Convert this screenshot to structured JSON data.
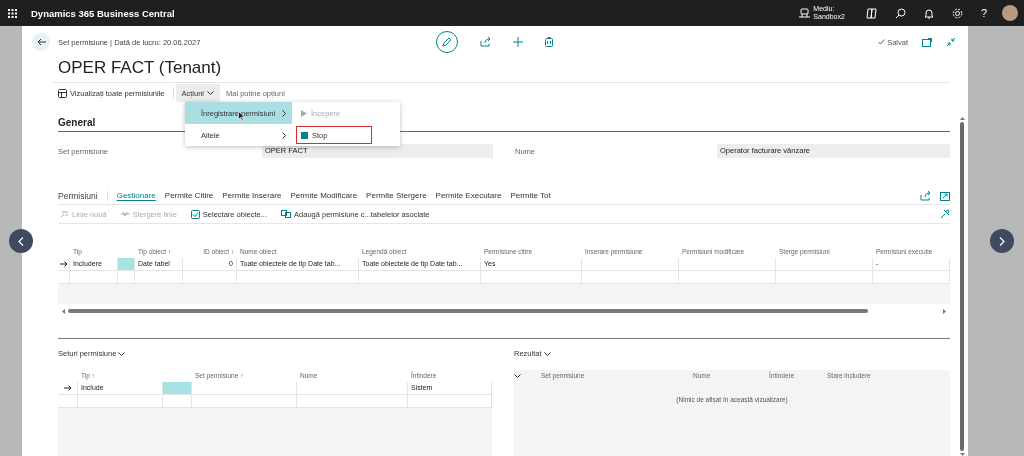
{
  "app_bar": {
    "title": "Dynamics 365 Business Central",
    "environment_label": "Mediu:",
    "environment_name": "Sandbox2",
    "help": "?"
  },
  "header": {
    "breadcrumb": "Set permisiune | Dată de lucru: 20.06.2027",
    "status": "Salvat",
    "title": "OPER FACT (Tenant)"
  },
  "actions": [
    {
      "label": "Vizualizați toate permisiunile",
      "kind": "button",
      "expanded": false
    },
    {
      "label": "Acțiuni",
      "kind": "menu",
      "expanded": true
    },
    {
      "label": "Mai puține opțiuni",
      "kind": "link",
      "expanded": false
    }
  ],
  "menu": {
    "items": [
      {
        "label": "Înregistrare permisiuni",
        "selected": true
      },
      {
        "label": "Altele",
        "selected": false
      }
    ],
    "submenu": [
      {
        "label": "Începere",
        "kind": "start",
        "disabled": true,
        "highlighted": false
      },
      {
        "label": "Stop",
        "kind": "stop",
        "disabled": false,
        "highlighted": true
      }
    ]
  },
  "general": {
    "title": "General",
    "fields": [
      {
        "label": "Set permisiune",
        "value": "OPER FACT"
      },
      {
        "label": "Nume",
        "value": "Operator facturare vânzare"
      }
    ]
  },
  "permissions": {
    "title": "Permisiuni",
    "tabs": [
      {
        "label": "Gestionare",
        "selected": true
      },
      {
        "label": "Permite Citire",
        "selected": false
      },
      {
        "label": "Permite Inserare",
        "selected": false
      },
      {
        "label": "Permite Modificare",
        "selected": false
      },
      {
        "label": "Permite Ștergere",
        "selected": false
      },
      {
        "label": "Permite Executare",
        "selected": false
      },
      {
        "label": "Permite Tot",
        "selected": false
      }
    ],
    "toolbar": [
      {
        "label": "Linie nouă",
        "kind": "new",
        "disabled": true
      },
      {
        "label": "Ștergere linie",
        "kind": "delete",
        "disabled": true
      },
      {
        "label": "Selectare obiecte...",
        "kind": "select",
        "disabled": false
      },
      {
        "label": "Adaugă permisiune c...tabelelor asociate",
        "kind": "add",
        "disabled": false
      }
    ],
    "table": {
      "columns": [
        "Tip",
        "Tip obiect ↑",
        "ID obiect ↑",
        "Nume obiect",
        "Legendă obiect",
        "Permisiune citire",
        "Inserare permisiune",
        "Permisiuni modificare",
        "Șterge permisiuni",
        "Permisiuni execuție"
      ],
      "rows": [
        {
          "selected": true,
          "cells": [
            "Includere",
            "Date tabel",
            "0",
            "Toate obiectele de tip Date tab...",
            "Toate obiectele de tip Date tab...",
            "Yes",
            null,
            null,
            null,
            "-"
          ]
        }
      ]
    }
  },
  "permission_sets": {
    "title": "Seturi permisiune",
    "columns": [
      "Tip ↑",
      "Set permisiune ↑",
      "Nume",
      "Întindere"
    ],
    "rows": [
      {
        "selected": true,
        "cells": [
          "Include",
          null,
          null,
          "Sistem"
        ]
      }
    ]
  },
  "result": {
    "title": "Rezultat",
    "columns": [
      "Set permisiune",
      "Nume",
      "Întindere",
      "Stare includere"
    ],
    "empty_message": "(Nimic de afișat în această vizualizare)"
  }
}
